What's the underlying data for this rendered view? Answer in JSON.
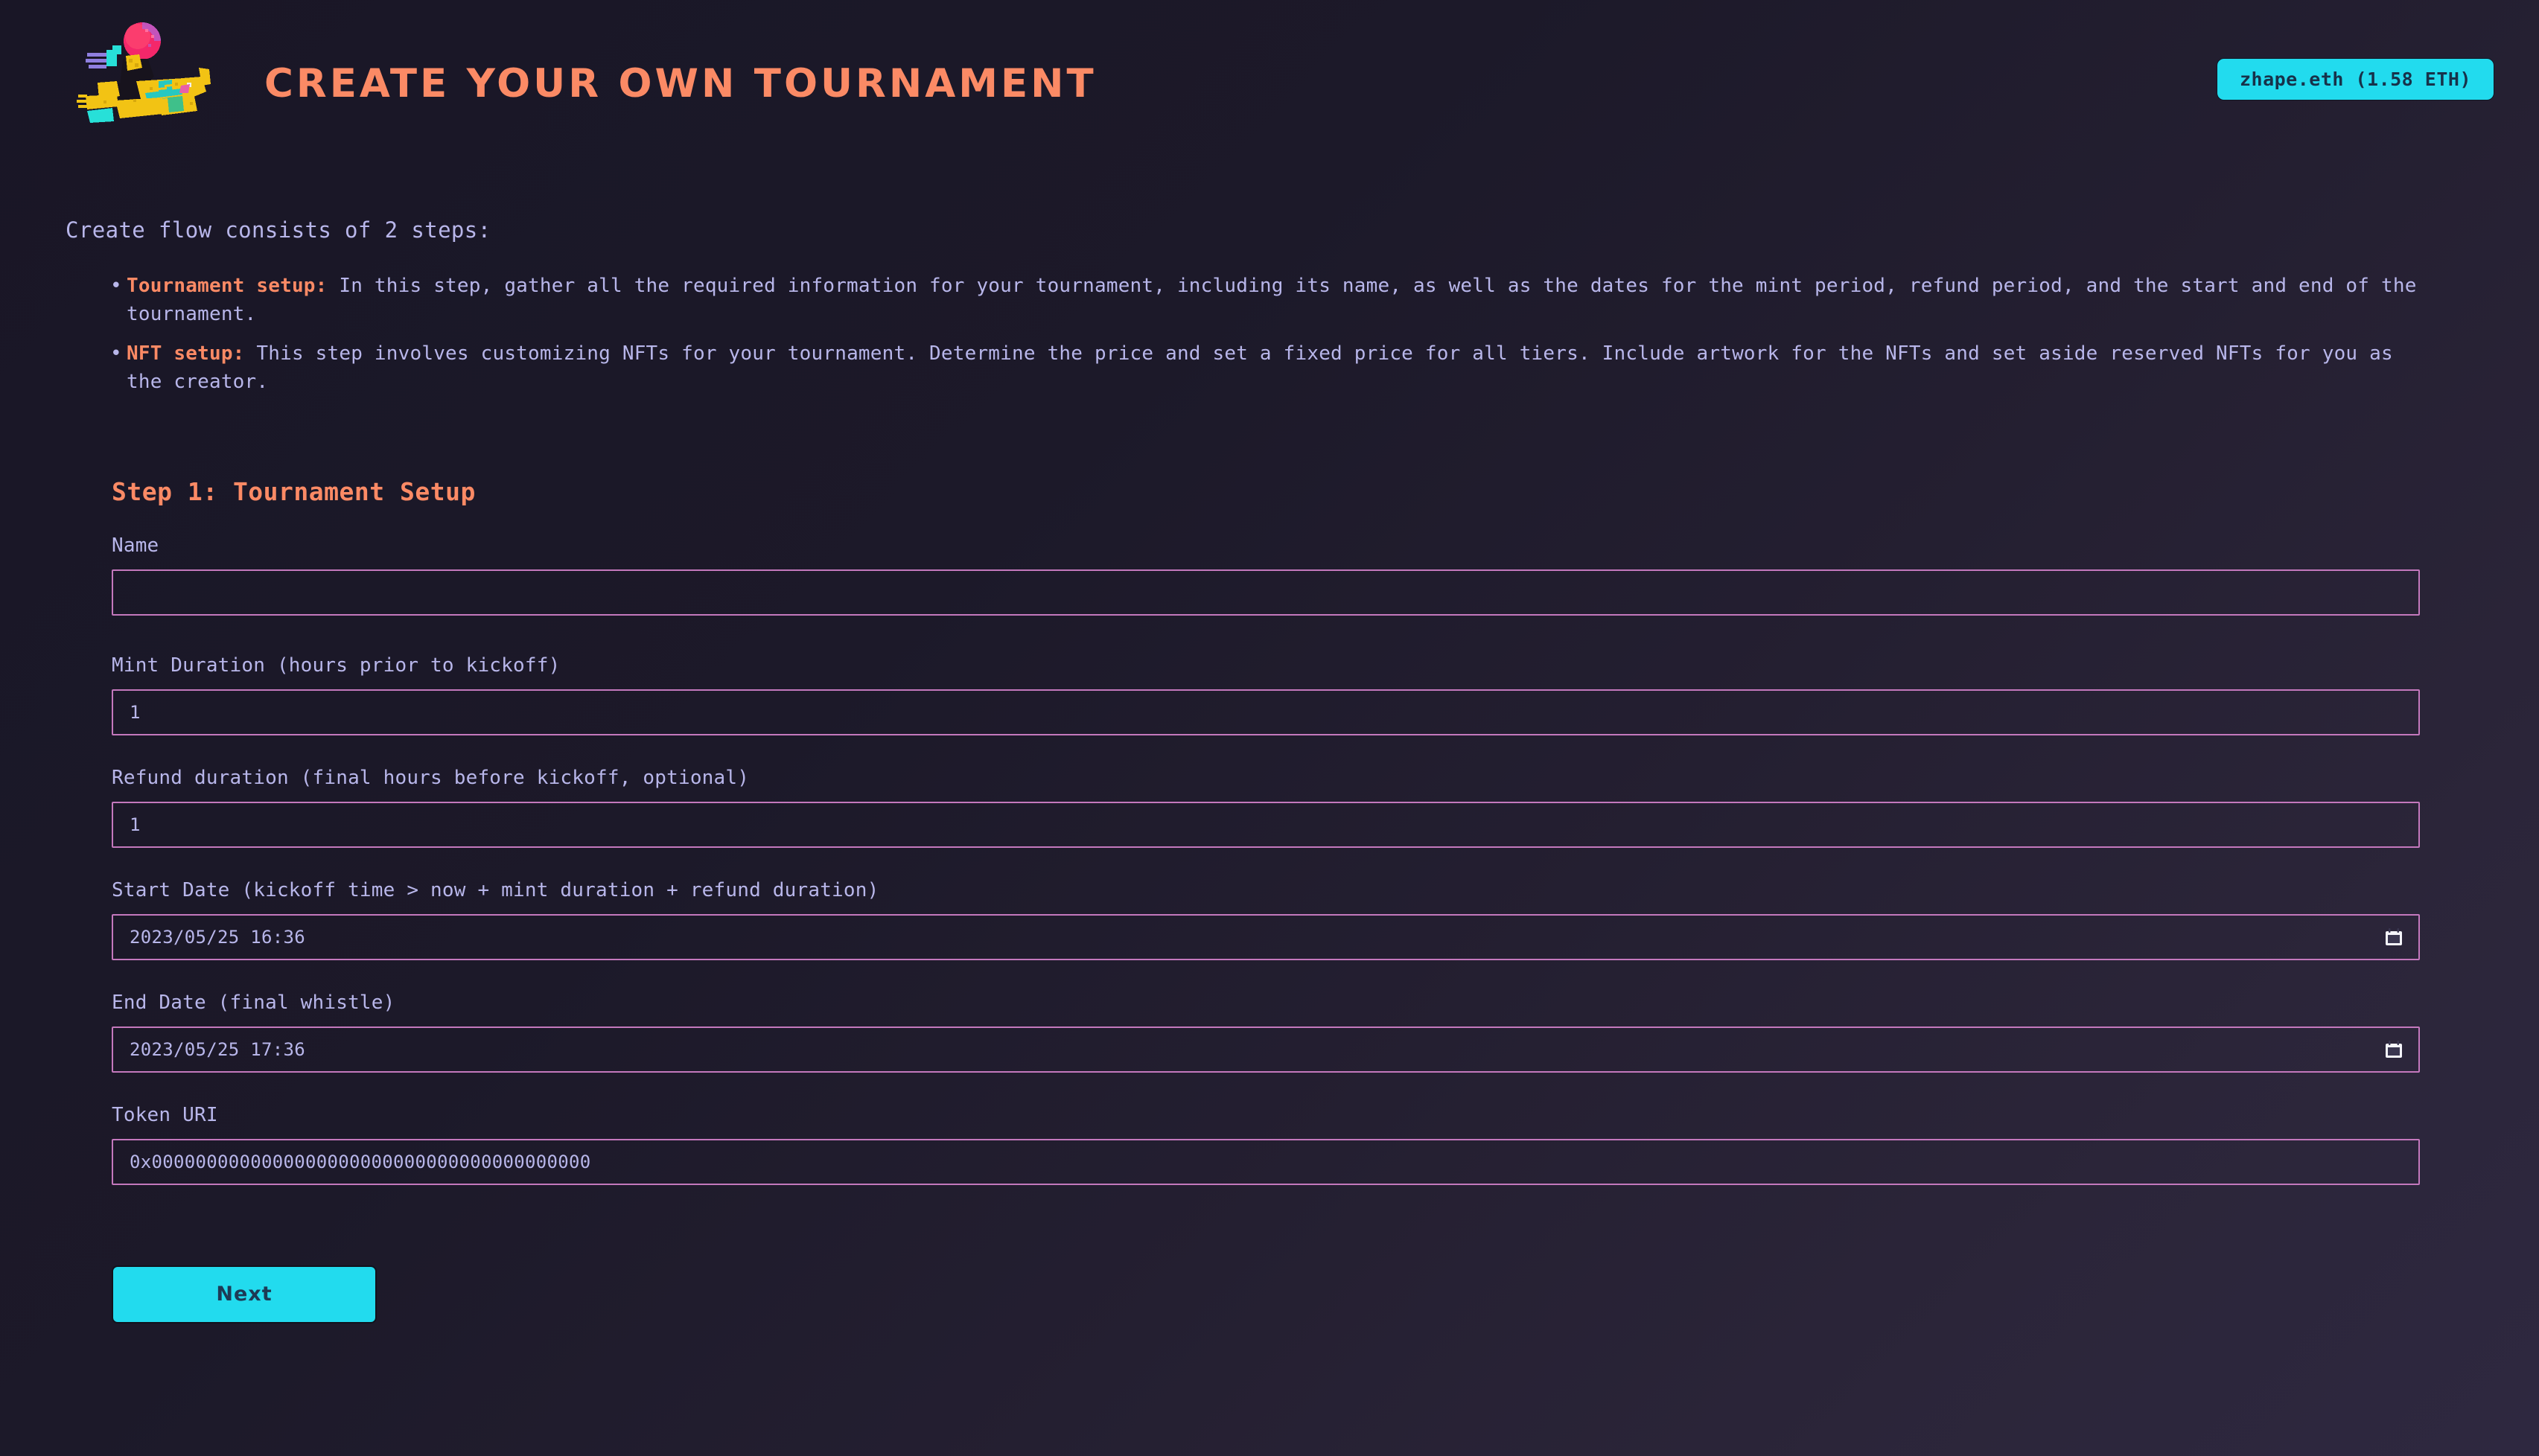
{
  "header": {
    "logo_alt": "pixel-art player diving with ball",
    "title": "CREATE YOUR OWN TOURNAMENT",
    "wallet_label": "zhape.eth (1.58 ETH)",
    "wallet_color": "#22dbee",
    "title_color": "#fb8a65"
  },
  "intro": {
    "line": "Create flow consists of 2 steps:",
    "bullets": [
      {
        "lead": "Tournament setup:",
        "text": " In this step, gather all the required information for your tournament, including its name, as well as the dates for the mint period, refund period, and the start and end of the tournament."
      },
      {
        "lead": "NFT setup:",
        "text": " This step involves customizing NFTs for your tournament. Determine the price and set a fixed price for all tiers. Include artwork for the NFTs and set aside reserved NFTs for you as the creator."
      }
    ]
  },
  "step": {
    "heading": "Step 1: Tournament Setup"
  },
  "fields": {
    "name": {
      "label": "Name",
      "value": "",
      "placeholder": ""
    },
    "mint_duration": {
      "label": "Mint Duration (hours prior to kickoff)",
      "value": "1"
    },
    "refund_duration": {
      "label": "Refund duration (final hours before kickoff, optional)",
      "value": "1"
    },
    "start_date": {
      "label": "Start Date (kickoff time > now + mint duration + refund duration)",
      "value": "2023/05/25 16:36",
      "icon": "calendar-icon"
    },
    "end_date": {
      "label": "End Date (final whistle)",
      "value": "2023/05/25 17:36",
      "icon": "calendar-icon"
    },
    "token_uri": {
      "label": "Token URI",
      "value": "0x0000000000000000000000000000000000000000"
    }
  },
  "actions": {
    "next_label": "Next"
  },
  "theme": {
    "background_top": "#191626",
    "background_bottom": "#2e2840",
    "text": "#b8b6ea",
    "accent_orange": "#fb8a65",
    "accent_cyan": "#22dbee",
    "input_border": "#c478bd"
  }
}
